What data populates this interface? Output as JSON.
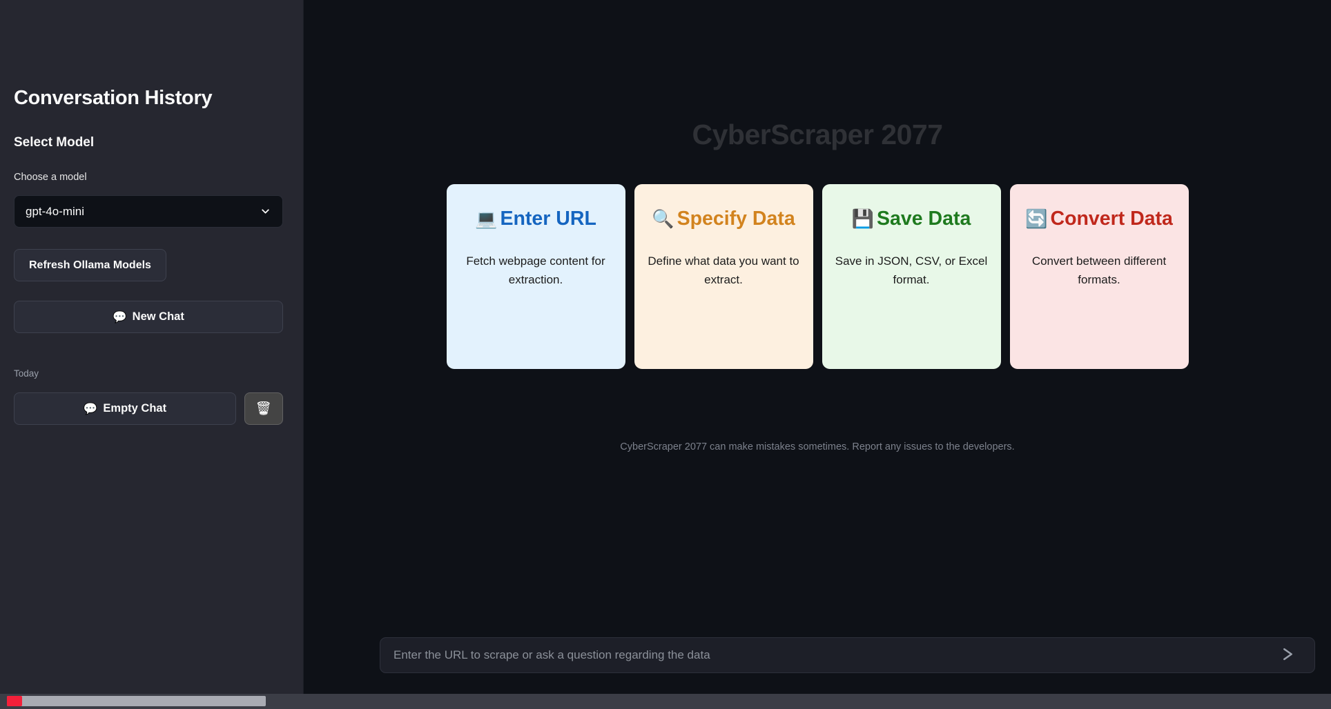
{
  "sidebar": {
    "title": "Conversation History",
    "select_model_label": "Select Model",
    "choose_model_label": "Choose a model",
    "model_value": "gpt-4o-mini",
    "chevron_icon": "chevron-down",
    "refresh_button": "Refresh Ollama Models",
    "new_chat_icon": "💬",
    "new_chat_button": "New Chat",
    "today_label": "Today",
    "chat_item_icon": "💬",
    "chat_item_label": "Empty Chat",
    "delete_icon": "🗑️",
    "bg_color": "#262730"
  },
  "main": {
    "app_title": "CyberScraper 2077",
    "app_title_color": "#2f3136",
    "bg_color": "#0e1117",
    "cards": [
      {
        "icon": "💻",
        "icon_name": "laptop-icon",
        "heading": "Enter URL",
        "body": "Fetch webpage content for extraction.",
        "bg": "#e3f2fd",
        "heading_color": "#1565c0"
      },
      {
        "icon": "🔍",
        "icon_name": "magnifier-icon",
        "heading": "Specify Data",
        "body": "Define what data you want to extract.",
        "bg": "#fdf0e0",
        "heading_color": "#d2831e"
      },
      {
        "icon": "💾",
        "icon_name": "floppy-disk-icon",
        "heading": "Save Data",
        "body": "Save in JSON, CSV, or Excel format.",
        "bg": "#e8f8e8",
        "heading_color": "#1e7a1e"
      },
      {
        "icon": "🔄",
        "icon_name": "convert-arrows-icon",
        "heading": "Convert Data",
        "body": "Convert between different formats.",
        "bg": "#fbe4e4",
        "heading_color": "#c0281c"
      }
    ],
    "disclaimer": "CyberScraper 2077 can make mistakes sometimes. Report any issues to the developers.",
    "input_placeholder": "Enter the URL to scrape or ask a question regarding the data",
    "input_value": "",
    "send_icon": "send-arrow"
  },
  "scrollbar": {
    "thumb_color": "#a9abb3",
    "marker_color": "#f4203a",
    "track_color": "#3b3d46"
  }
}
